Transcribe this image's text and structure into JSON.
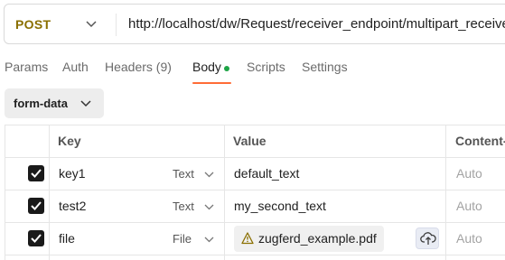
{
  "request": {
    "method": "POST",
    "url": "http://localhost/dw/Request/receiver_endpoint/multipart_receiver/"
  },
  "tabs": [
    {
      "label": "Params"
    },
    {
      "label": "Auth"
    },
    {
      "label": "Headers (9)"
    },
    {
      "label": "Body",
      "active": true,
      "indicator": "green-dot"
    },
    {
      "label": "Scripts"
    },
    {
      "label": "Settings"
    }
  ],
  "body_type": {
    "selected": "form-data"
  },
  "table": {
    "columns": [
      "Key",
      "Value",
      "Content-"
    ],
    "rows": [
      {
        "checked": true,
        "key": "key1",
        "type": "Text",
        "value": "default_text",
        "content_type": "Auto"
      },
      {
        "checked": true,
        "key": "test2",
        "type": "Text",
        "value": "my_second_text",
        "content_type": "Auto"
      },
      {
        "checked": true,
        "key": "file",
        "type": "File",
        "value": "zugferd_example.pdf",
        "value_icon": "warning-triangle-icon",
        "content_type": "Auto"
      }
    ]
  },
  "colors": {
    "method": "#8a6f00",
    "active_tab_underline": "#ff6c37",
    "body_indicator": "#1ea446",
    "checkbox": "#1a1a1a"
  }
}
